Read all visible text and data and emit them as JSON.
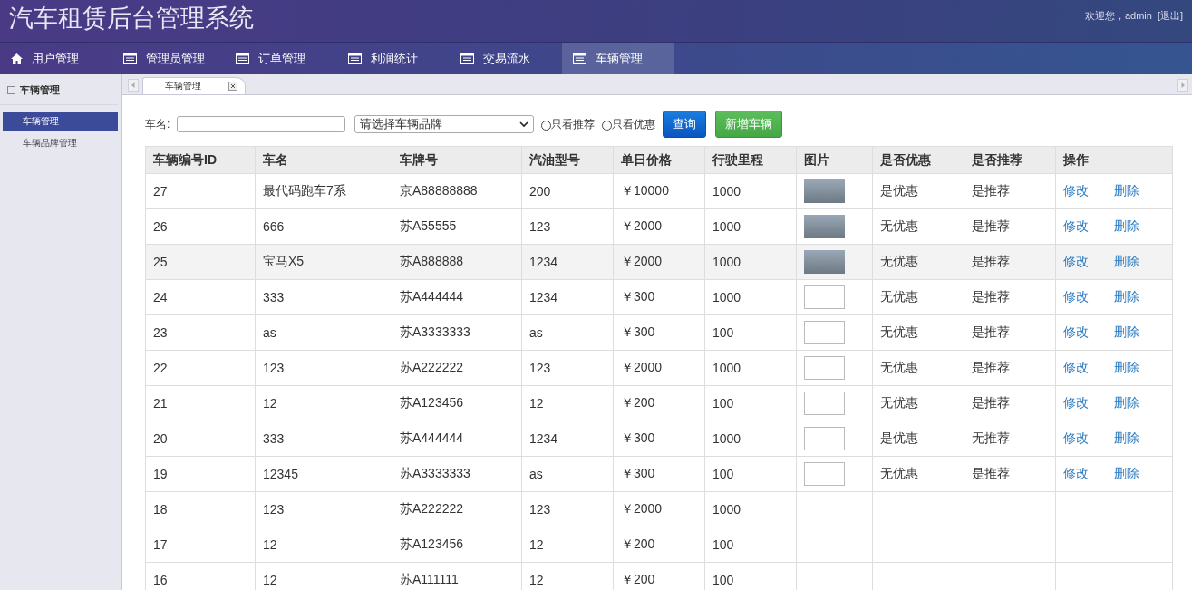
{
  "header": {
    "title": "汽车租赁后台管理系统",
    "welcome": "欢迎您，admin",
    "logout": "[退出]"
  },
  "nav": [
    {
      "label": "用户管理",
      "kind": "home",
      "selected": false
    },
    {
      "label": "管理员管理",
      "kind": "table",
      "selected": false
    },
    {
      "label": "订单管理",
      "kind": "table",
      "selected": false
    },
    {
      "label": "利润统计",
      "kind": "table",
      "selected": false
    },
    {
      "label": "交易流水",
      "kind": "table",
      "selected": false
    },
    {
      "label": "车辆管理",
      "kind": "table",
      "selected": true
    }
  ],
  "sidebar": {
    "group": "车辆管理",
    "items": [
      {
        "label": "车辆管理",
        "selected": true
      },
      {
        "label": "车辆品牌管理",
        "selected": false
      }
    ]
  },
  "tabs": [
    {
      "label": "车辆管理",
      "selected": true
    }
  ],
  "filters": {
    "name_label": "车名:",
    "brand_placeholder": "请选择车辆品牌",
    "radios": [
      {
        "label": "只看推荐",
        "checked": false
      },
      {
        "label": "只看优惠",
        "checked": false
      }
    ],
    "buttons": [
      {
        "label": "查询",
        "kind": "primary"
      },
      {
        "label": "新增车辆",
        "kind": "success"
      }
    ]
  },
  "table": {
    "columns": [
      "车辆编号ID",
      "车名",
      "车牌号",
      "汽油型号",
      "单日价格",
      "行驶里程",
      "图片",
      "是否优惠",
      "是否推荐",
      "操作"
    ],
    "rows": [
      {
        "id": "27",
        "name": "最代码跑车7系",
        "plate": "京A88888888",
        "fuel": "200",
        "price": "￥10000",
        "mileage": "1000",
        "kind": "photo",
        "discount": "是优惠",
        "recommend": "是推荐",
        "actions": [
          "修改",
          "删除"
        ],
        "hover": false
      },
      {
        "id": "26",
        "name": "666",
        "plate": "苏A55555",
        "fuel": "123",
        "price": "￥2000",
        "mileage": "1000",
        "kind": "photo",
        "discount": "无优惠",
        "recommend": "是推荐",
        "actions": [
          "修改",
          "删除"
        ],
        "hover": false
      },
      {
        "id": "25",
        "name": "宝马X5",
        "plate": "苏A888888",
        "fuel": "1234",
        "price": "￥2000",
        "mileage": "1000",
        "kind": "photo",
        "discount": "无优惠",
        "recommend": "是推荐",
        "actions": [
          "修改",
          "删除"
        ],
        "hover": true
      },
      {
        "id": "24",
        "name": "333",
        "plate": "苏A444444",
        "fuel": "1234",
        "price": "￥300",
        "mileage": "1000",
        "kind": "broken",
        "discount": "无优惠",
        "recommend": "是推荐",
        "actions": [
          "修改",
          "删除"
        ],
        "hover": false
      },
      {
        "id": "23",
        "name": "as",
        "plate": "苏A3333333",
        "fuel": "as",
        "price": "￥300",
        "mileage": "100",
        "kind": "broken",
        "discount": "无优惠",
        "recommend": "是推荐",
        "actions": [
          "修改",
          "删除"
        ],
        "hover": false
      },
      {
        "id": "22",
        "name": "123",
        "plate": "苏A222222",
        "fuel": "123",
        "price": "￥2000",
        "mileage": "1000",
        "kind": "broken",
        "discount": "无优惠",
        "recommend": "是推荐",
        "actions": [
          "修改",
          "删除"
        ],
        "hover": false
      },
      {
        "id": "21",
        "name": "12",
        "plate": "苏A123456",
        "fuel": "12",
        "price": "￥200",
        "mileage": "100",
        "kind": "broken",
        "discount": "无优惠",
        "recommend": "是推荐",
        "actions": [
          "修改",
          "删除"
        ],
        "hover": false
      },
      {
        "id": "20",
        "name": "333",
        "plate": "苏A444444",
        "fuel": "1234",
        "price": "￥300",
        "mileage": "1000",
        "kind": "broken",
        "discount": "是优惠",
        "recommend": "无推荐",
        "actions": [
          "修改",
          "删除"
        ],
        "hover": false
      },
      {
        "id": "19",
        "name": "12345",
        "plate": "苏A3333333",
        "fuel": "as",
        "price": "￥300",
        "mileage": "100",
        "kind": "broken",
        "discount": "无优惠",
        "recommend": "是推荐",
        "actions": [
          "修改",
          "删除"
        ],
        "hover": false
      },
      {
        "id": "18",
        "name": "123",
        "plate": "苏A222222",
        "fuel": "123",
        "price": "￥2000",
        "mileage": "1000",
        "hover": false
      },
      {
        "id": "17",
        "name": "12",
        "plate": "苏A123456",
        "fuel": "12",
        "price": "￥200",
        "mileage": "100",
        "hover": false
      },
      {
        "id": "16",
        "name": "12",
        "plate": "苏A111111",
        "fuel": "12",
        "price": "￥200",
        "mileage": "100",
        "hover": false
      }
    ]
  }
}
